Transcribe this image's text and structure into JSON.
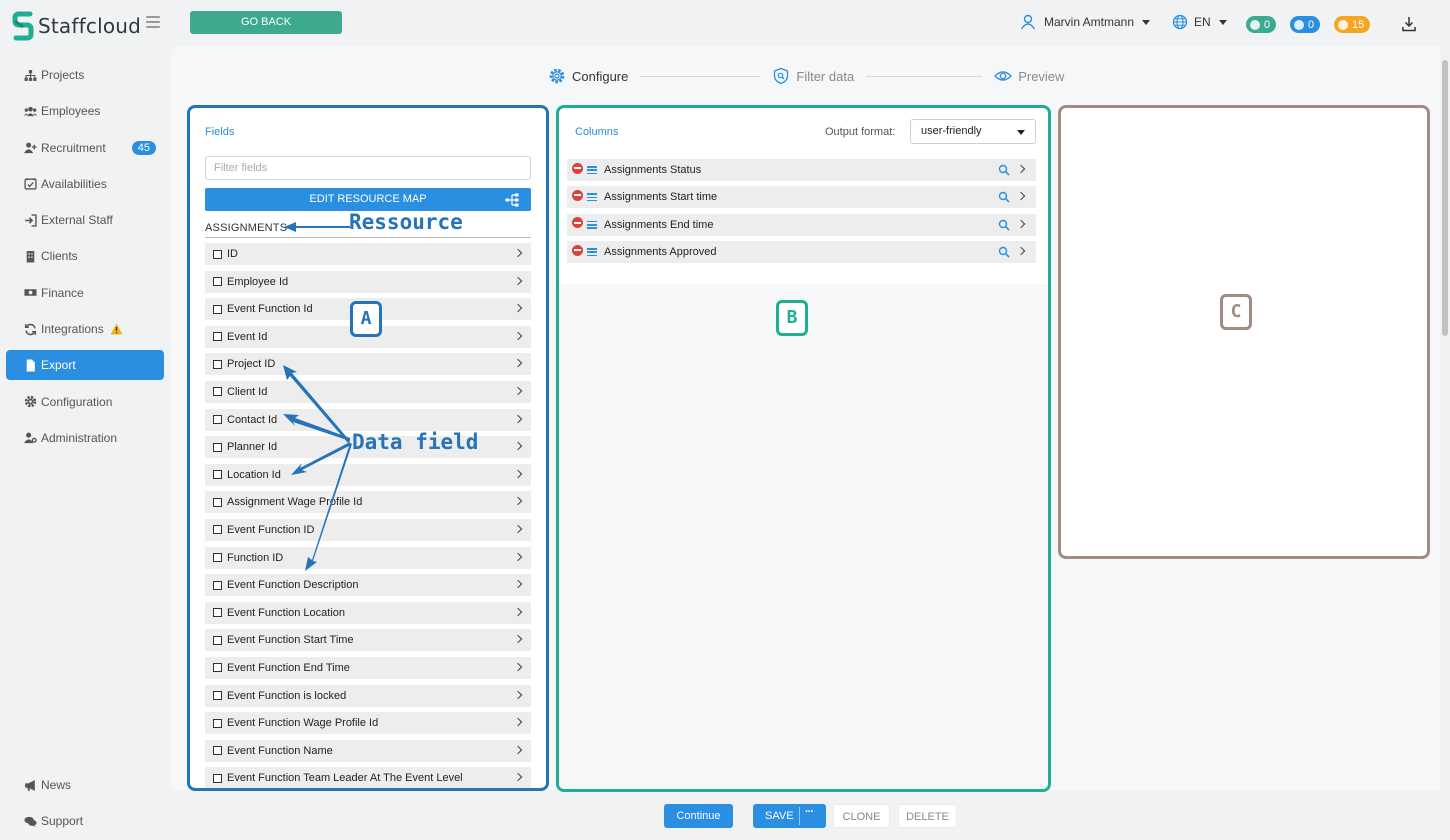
{
  "app": {
    "name": "Staffcloud",
    "brand_color": "#1fae94",
    "accent_color": "#2a8fe0"
  },
  "topbar": {
    "go_back": "GO BACK",
    "user_name": "Marvin Amtmann",
    "language": "EN",
    "badges": [
      {
        "name": "messages",
        "count": "0",
        "color": "#3daa8f"
      },
      {
        "name": "notifications",
        "count": "0",
        "color": "#2a8fe0"
      },
      {
        "name": "timers",
        "count": "15",
        "color": "#f5a623"
      }
    ]
  },
  "sidebar": {
    "items": [
      {
        "label": "Projects",
        "icon": "sitemap-icon"
      },
      {
        "label": "Employees",
        "icon": "users-icon"
      },
      {
        "label": "Recruitment",
        "icon": "user-plus-icon",
        "badge": "45"
      },
      {
        "label": "Availabilities",
        "icon": "calendar-check-icon"
      },
      {
        "label": "External Staff",
        "icon": "sign-in-icon"
      },
      {
        "label": "Clients",
        "icon": "building-icon"
      },
      {
        "label": "Finance",
        "icon": "money-icon"
      },
      {
        "label": "Integrations",
        "icon": "sync-icon",
        "warning": true
      },
      {
        "label": "Export",
        "icon": "file-icon",
        "active": true
      },
      {
        "label": "Configuration",
        "icon": "cog-icon"
      },
      {
        "label": "Administration",
        "icon": "user-cog-icon"
      }
    ],
    "bottom": [
      {
        "label": "News",
        "icon": "bullhorn-icon"
      },
      {
        "label": "Support",
        "icon": "comments-icon"
      }
    ]
  },
  "steps": [
    {
      "label": "Configure",
      "icon": "gear-icon",
      "active": true
    },
    {
      "label": "Filter data",
      "icon": "shield-search-icon"
    },
    {
      "label": "Preview",
      "icon": "eye-icon"
    }
  ],
  "fields_panel": {
    "title": "Fields",
    "filter_placeholder": "Filter fields",
    "edit_button": "EDIT RESOURCE MAP",
    "resource": "ASSIGNMENTS",
    "fields": [
      "ID",
      "Employee Id",
      "Event Function Id",
      "Event Id",
      "Project ID",
      "Client Id",
      "Contact Id",
      "Planner Id",
      "Location Id",
      "Assignment Wage Profile Id",
      "Event Function ID",
      "Function ID",
      "Event Function Description",
      "Event Function Location",
      "Event Function Start Time",
      "Event Function End Time",
      "Event Function is locked",
      "Event Function Wage Profile Id",
      "Event Function Name",
      "Event Function Team Leader At The Event Level"
    ]
  },
  "columns_panel": {
    "title": "Columns",
    "output_label": "Output format:",
    "output_value": "user-friendly",
    "columns": [
      "Assignments Status",
      "Assignments Start time",
      "Assignments End time",
      "Assignments Approved"
    ]
  },
  "annotations": {
    "box_a": "A",
    "box_b": "B",
    "box_c": "C",
    "ressource": "Ressource",
    "data_field": "Data field"
  },
  "bottom_bar": {
    "continue": "Continue",
    "save": "SAVE",
    "more": "···",
    "clone": "CLONE",
    "delete": "DELETE"
  }
}
